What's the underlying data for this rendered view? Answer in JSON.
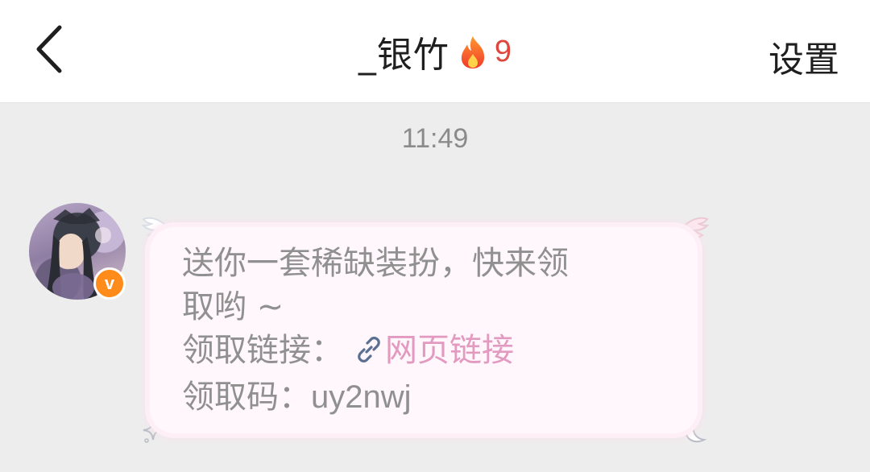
{
  "header": {
    "back_icon": "chevron-left-icon",
    "title": "_银竹",
    "streak_icon": "fire-icon",
    "streak_count": "9",
    "settings_label": "设置"
  },
  "chat": {
    "timestamp": "11:49",
    "message": {
      "verified_badge": "v",
      "line1": "送你一套稀缺装扮，快来领",
      "line2": "取哟 ~",
      "link_label": "领取链接：",
      "link_text": "网页链接",
      "code_label": "领取码：",
      "code_value": "uy2nwj"
    }
  },
  "colors": {
    "background": "#ededed",
    "header_bg": "#ffffff",
    "streak_red": "#e0463c",
    "link_pink": "#e39ac0",
    "bubble_bg": "#fff7fb",
    "badge_orange": "#ff8c1a"
  }
}
